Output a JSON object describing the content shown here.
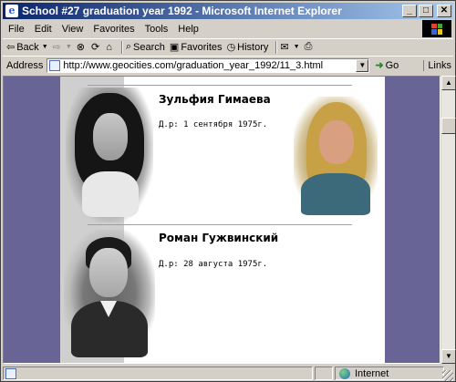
{
  "window": {
    "title": "School #27 graduation year 1992 - Microsoft Internet Explorer",
    "minimize": "_",
    "maximize": "□",
    "close": "✕"
  },
  "menu": [
    "File",
    "Edit",
    "View",
    "Favorites",
    "Tools",
    "Help"
  ],
  "toolbar": {
    "back": "Back",
    "search": "Search",
    "favorites": "Favorites",
    "history": "History"
  },
  "address": {
    "label": "Address",
    "url": "http://www.geocities.com/graduation_year_1992/11_3.html",
    "go": "Go",
    "links": "Links"
  },
  "page": {
    "people": [
      {
        "name": "Зульфия Гимаева",
        "dob": "Д.р: 1 сентября 1975г."
      },
      {
        "name": "Роман Гужвинский",
        "dob": "Д.р: 28 августа 1975г."
      }
    ]
  },
  "status": {
    "text": "",
    "zone": "Internet"
  }
}
